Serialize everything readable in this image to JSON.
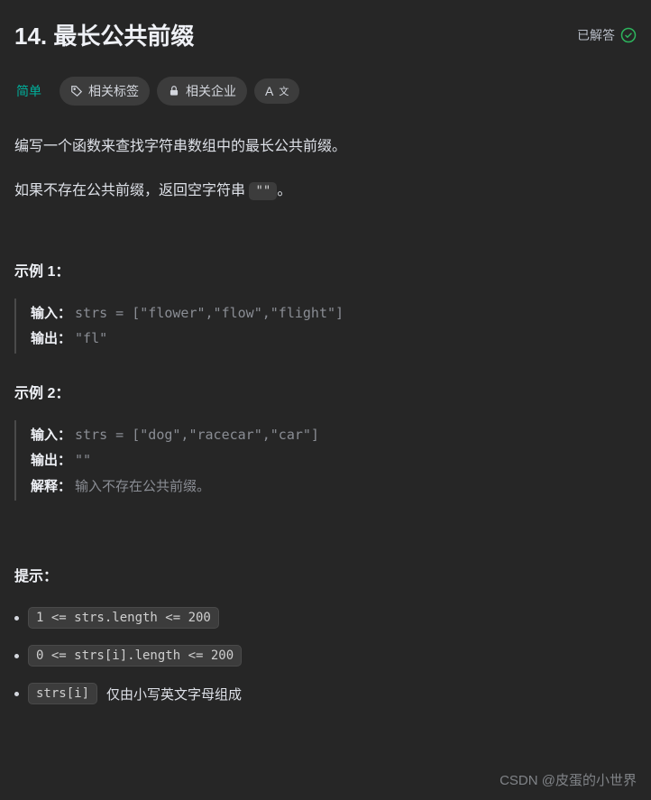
{
  "header": {
    "title": "14. 最长公共前缀",
    "status_label": "已解答"
  },
  "tags": {
    "difficulty": "简单",
    "related_tags": "相关标签",
    "related_companies": "相关企业",
    "translate": "A"
  },
  "description": {
    "line1": "编写一个函数来查找字符串数组中的最长公共前缀。",
    "line2_prefix": "如果不存在公共前缀，返回空字符串 ",
    "line2_code": "\"\"",
    "line2_suffix": "。"
  },
  "examples": [
    {
      "title": "示例 1：",
      "input_label": "输入：",
      "input_value": "strs = [\"flower\",\"flow\",\"flight\"]",
      "output_label": "输出：",
      "output_value": "\"fl\""
    },
    {
      "title": "示例 2：",
      "input_label": "输入：",
      "input_value": "strs = [\"dog\",\"racecar\",\"car\"]",
      "output_label": "输出：",
      "output_value": "\"\"",
      "explain_label": "解释：",
      "explain_value": "输入不存在公共前缀。"
    }
  ],
  "hints": {
    "title": "提示：",
    "items": [
      {
        "code": "1 <= strs.length <= 200",
        "text": ""
      },
      {
        "code": "0 <= strs[i].length <= 200",
        "text": ""
      },
      {
        "code": "strs[i]",
        "text": " 仅由小写英文字母组成"
      }
    ]
  },
  "watermark": "CSDN @皮蛋的小世界"
}
